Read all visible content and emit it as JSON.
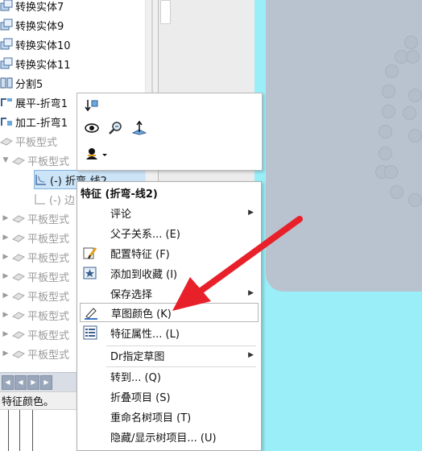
{
  "tree": {
    "items": [
      {
        "label": "转换实体7",
        "icon": "convert-entities-icon",
        "dim": false
      },
      {
        "label": "转换实体9",
        "icon": "convert-entities-icon",
        "dim": false
      },
      {
        "label": "转换实体10",
        "icon": "convert-entities-icon",
        "dim": false
      },
      {
        "label": "转换实体11",
        "icon": "convert-entities-icon",
        "dim": false
      },
      {
        "label": "分割5",
        "icon": "split-icon",
        "dim": false
      },
      {
        "label": "展平-折弯1",
        "icon": "flatten-bend-icon",
        "dim": false
      },
      {
        "label": "加工-折弯1",
        "icon": "process-bend-icon",
        "dim": false
      },
      {
        "label": "平板型式",
        "icon": "flat-pattern-icon",
        "dim": true
      },
      {
        "label": "平板型式",
        "icon": "flat-pattern-icon",
        "dim": true
      },
      {
        "label": "(-) 折弯-线2",
        "icon": "sketch-icon",
        "dim": false
      },
      {
        "label": "(-) 边",
        "icon": "sketch-icon",
        "dim": true
      },
      {
        "label": "平板型式",
        "icon": "flat-pattern-icon",
        "dim": true
      },
      {
        "label": "平板型式",
        "icon": "flat-pattern-icon",
        "dim": true
      },
      {
        "label": "平板型式",
        "icon": "flat-pattern-icon",
        "dim": true
      },
      {
        "label": "平板型式",
        "icon": "flat-pattern-icon",
        "dim": true
      },
      {
        "label": "平板型式",
        "icon": "flat-pattern-icon",
        "dim": true
      },
      {
        "label": "平板型式",
        "icon": "flat-pattern-icon",
        "dim": true
      },
      {
        "label": "平板型式",
        "icon": "flat-pattern-icon",
        "dim": true
      },
      {
        "label": "平板型式",
        "icon": "flat-pattern-icon",
        "dim": true
      }
    ]
  },
  "status_bar": {
    "text": "特征颜色。"
  },
  "context_toolbar": {
    "buttons": [
      {
        "icon": "rollback-icon"
      },
      {
        "icon": "show-hide-icon"
      },
      {
        "icon": "zoom-to-selection-icon"
      },
      {
        "icon": "normal-to-icon"
      },
      {
        "icon": "appearance-icon"
      }
    ]
  },
  "context_menu": {
    "title": "特征 (折弯-线2)",
    "items": [
      {
        "label": "评论",
        "submenu": true,
        "icon": ""
      },
      {
        "label": "父子关系... (E)",
        "submenu": false,
        "icon": ""
      },
      {
        "label": "配置特征 (F)",
        "submenu": false,
        "icon": "configure-feature-icon"
      },
      {
        "label": "添加到收藏 (I)",
        "submenu": false,
        "icon": "add-favorite-icon"
      },
      {
        "label": "保存选择",
        "submenu": true,
        "icon": ""
      },
      {
        "label": "草图颜色 (K)",
        "submenu": false,
        "icon": "sketch-color-icon",
        "highlighted": true
      },
      {
        "label": "特征属性... (L)",
        "submenu": false,
        "icon": "feature-properties-icon"
      },
      {
        "label": "Dr指定草图",
        "submenu": true,
        "icon": ""
      },
      {
        "label": "转到... (Q)",
        "submenu": false,
        "icon": ""
      },
      {
        "label": "折叠项目 (S)",
        "submenu": false,
        "icon": ""
      },
      {
        "label": "重命名树项目 (T)",
        "submenu": false,
        "icon": ""
      },
      {
        "label": "隐藏/显示树项目... (U)",
        "submenu": false,
        "icon": ""
      }
    ]
  },
  "colors": {
    "part_cyan": "#99eef8",
    "part_gray": "#b9c3cf",
    "arrow_red": "#e8202a",
    "selection_blue": "#3a78c8"
  }
}
